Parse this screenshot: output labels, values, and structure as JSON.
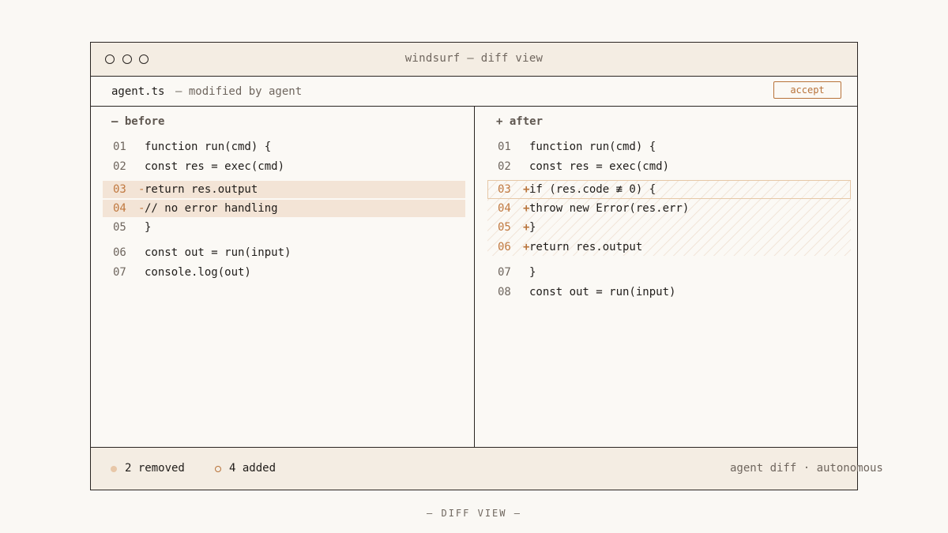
{
  "window": {
    "title": "windsurf — diff view"
  },
  "file": {
    "name": "agent.ts",
    "note": "— modified by agent",
    "accept_label": "accept"
  },
  "before": {
    "header": "— before",
    "lines": [
      {
        "num": "01",
        "marker": "",
        "code": "function run(cmd) {",
        "status": "context"
      },
      {
        "num": "02",
        "marker": "",
        "code": "const res = exec(cmd)",
        "status": "context"
      },
      {
        "num": "03",
        "marker": "-",
        "code": "return res.output",
        "status": "removed"
      },
      {
        "num": "04",
        "marker": "-",
        "code": "// no error handling",
        "status": "removed"
      },
      {
        "num": "05",
        "marker": "",
        "code": "}",
        "status": "context"
      },
      {
        "num": "06",
        "marker": "",
        "code": "const out = run(input)",
        "status": "context"
      },
      {
        "num": "07",
        "marker": "",
        "code": "console.log(out)",
        "status": "context"
      }
    ]
  },
  "after": {
    "header": "+ after",
    "lines": [
      {
        "num": "01",
        "marker": "",
        "code": "function run(cmd) {",
        "status": "context"
      },
      {
        "num": "02",
        "marker": "",
        "code": "const res = exec(cmd)",
        "status": "context"
      },
      {
        "num": "03",
        "marker": "+",
        "code": "if (res.code ≢ 0) {",
        "status": "added"
      },
      {
        "num": "04",
        "marker": "+",
        "code": "throw new Error(res.err)",
        "status": "added"
      },
      {
        "num": "05",
        "marker": "+",
        "code": "}",
        "status": "added"
      },
      {
        "num": "06",
        "marker": "+",
        "code": "return res.output",
        "status": "added"
      },
      {
        "num": "07",
        "marker": "",
        "code": "}",
        "status": "context"
      },
      {
        "num": "08",
        "marker": "",
        "code": "const out = run(input)",
        "status": "context"
      }
    ]
  },
  "footer": {
    "removed_label": "2 removed",
    "added_label": "4 added",
    "meta": "agent diff · autonomous"
  },
  "caption": "— DIFF VIEW —",
  "colors": {
    "accent": "#b8733a",
    "removed_bg": "#f3e4d6",
    "panel_bg": "#f4ede3",
    "border": "#2a2522"
  }
}
